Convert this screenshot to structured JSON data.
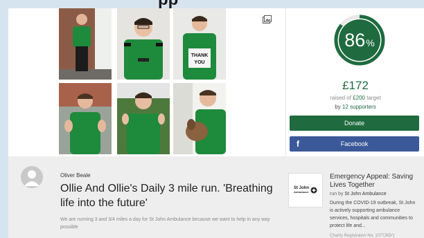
{
  "header": {
    "title_text": "pp"
  },
  "gallery": {
    "expand_icon": "gallery-expand-icon",
    "sign_text": "THANK YOU"
  },
  "progress": {
    "percent": 86,
    "percent_label": "86",
    "percent_sign": "%",
    "raised_amount": "£172",
    "raised_prefix": "raised of ",
    "target": "£200",
    "target_suffix": " target",
    "by_label": "by ",
    "supporters_count": "12 supporters",
    "ring_color": "#1f6b3f",
    "ring_track_color": "#e8e8e8"
  },
  "actions": {
    "donate_label": "Donate",
    "facebook_label": "Facebook",
    "facebook_icon": "f"
  },
  "fundraiser": {
    "organiser": "Oliver Beale",
    "title": "Ollie And Ollie's Daily 3 mile run. 'Breathing life into the future'",
    "summary": "We are running 3 and 3/4 miles a day for St John Ambulance because we want to help in any way possible"
  },
  "charity": {
    "logo_line1": "St John",
    "logo_line2": "Ambulance",
    "title": "Emergency Appeal: Saving Lives Together",
    "run_by_prefix": "run by ",
    "run_by_name": "St John Ambulance",
    "description": "During the COVID-19 outbreak, St John is actively supporting ambulance services, hospitals and communities to protect life and...",
    "registration": "Charity Registration No. 1077265/1"
  },
  "colors": {
    "brand_green": "#1f6b3f",
    "facebook_blue": "#3b5998",
    "page_background": "#d6e4f0"
  }
}
